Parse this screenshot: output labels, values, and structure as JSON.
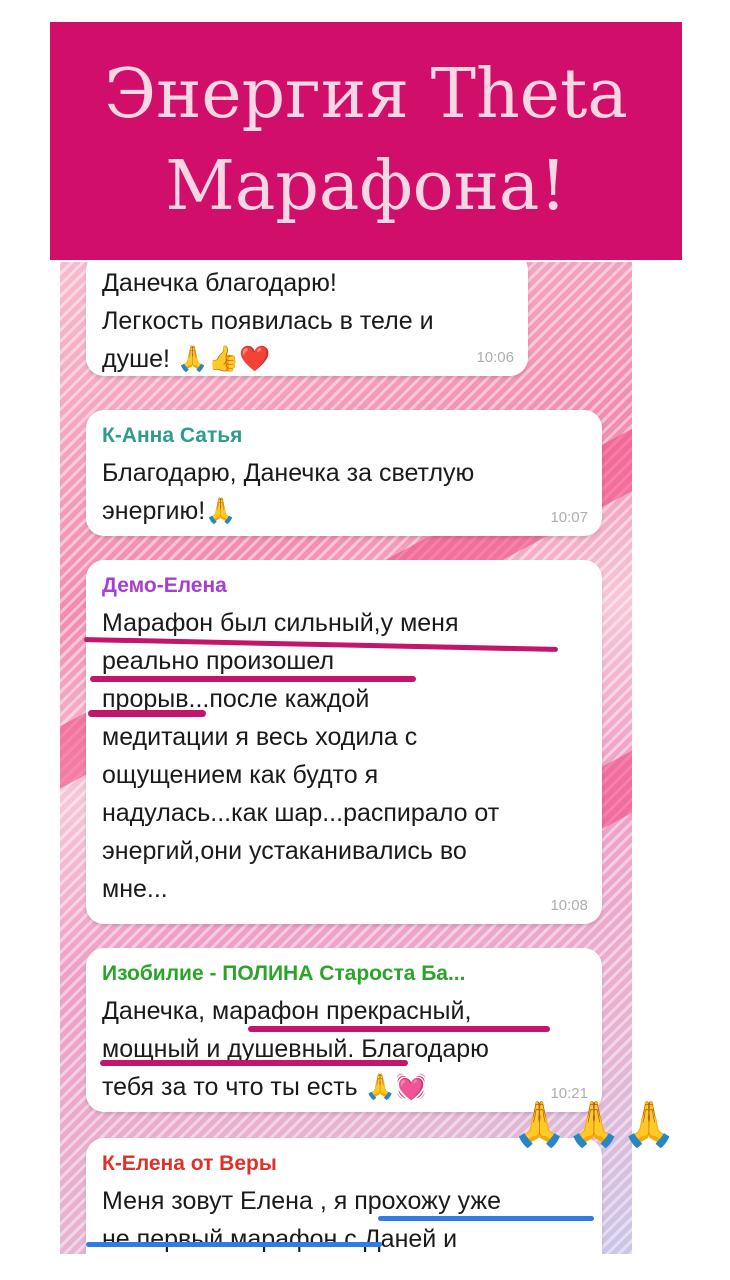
{
  "banner": {
    "line1": "Энергия Theta",
    "line2": "Марафона!"
  },
  "messages": [
    {
      "sender": "",
      "lines": [
        "Данечка благодарю!",
        "Легкость появилась в теле и",
        "душе!"
      ],
      "emoji": "🙏👍❤️",
      "time": "10:06"
    },
    {
      "sender": "К-Анна Сатья",
      "sender_color": "#2e9c8a",
      "lines": [
        "Благодарю, Данечка за светлую",
        "энергию!"
      ],
      "emoji": "🙏",
      "time": "10:07"
    },
    {
      "sender": "Демо-Елена",
      "sender_color": "#a63fd1",
      "lines": [
        "Марафон был сильный,у меня",
        "реально произошел",
        "прорыв...после каждой",
        "медитации я весь ходила с",
        "ощущением как будто я",
        "надулась...как шар...распирало от",
        "энергий,они устаканивались во",
        "мне..."
      ],
      "time": "10:08"
    },
    {
      "sender": "Изобилие - ПОЛИНА  Староста Ба...",
      "sender_color": "#2aa52a",
      "lines": [
        "Данечка, марафон прекрасный,",
        "мощный и душевный. Благодарю",
        "тебя за то что ты есть"
      ],
      "emoji": "🙏💓",
      "time": "10:21"
    },
    {
      "sender": "К-Елена от Веры",
      "sender_color": "#e0302a",
      "lines": [
        "Меня зовут Елена , я прохожу уже",
        "не первый марафон с Даней и"
      ]
    }
  ],
  "overlay_emoji": "🙏🙏🙏",
  "colors": {
    "banner": "#d10f6b",
    "banner_text": "#f6d7e2",
    "underline_pink": "#c2156b",
    "underline_blue": "#2f7de0"
  }
}
